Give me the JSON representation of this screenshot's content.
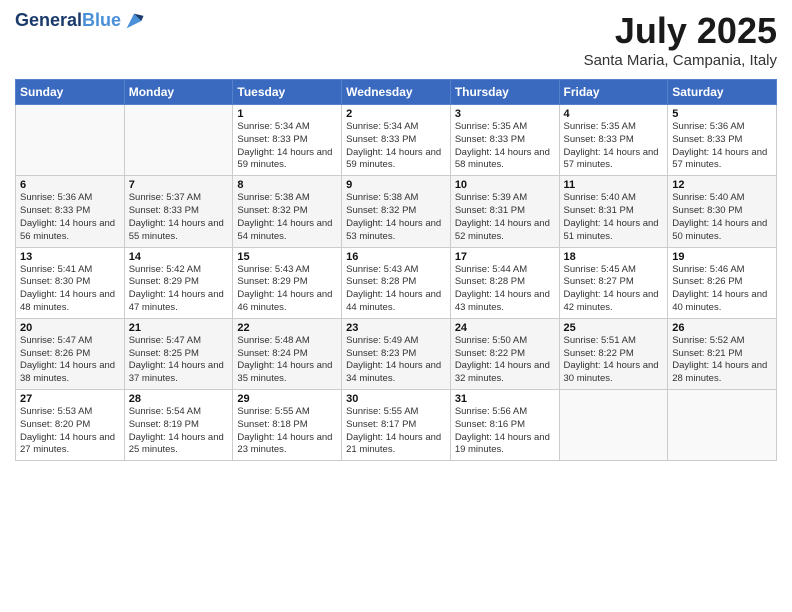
{
  "header": {
    "logo_line1": "General",
    "logo_line2": "Blue",
    "month": "July 2025",
    "location": "Santa Maria, Campania, Italy"
  },
  "weekdays": [
    "Sunday",
    "Monday",
    "Tuesday",
    "Wednesday",
    "Thursday",
    "Friday",
    "Saturday"
  ],
  "weeks": [
    [
      {
        "day": "",
        "sunrise": "",
        "sunset": "",
        "daylight": ""
      },
      {
        "day": "",
        "sunrise": "",
        "sunset": "",
        "daylight": ""
      },
      {
        "day": "1",
        "sunrise": "Sunrise: 5:34 AM",
        "sunset": "Sunset: 8:33 PM",
        "daylight": "Daylight: 14 hours and 59 minutes."
      },
      {
        "day": "2",
        "sunrise": "Sunrise: 5:34 AM",
        "sunset": "Sunset: 8:33 PM",
        "daylight": "Daylight: 14 hours and 59 minutes."
      },
      {
        "day": "3",
        "sunrise": "Sunrise: 5:35 AM",
        "sunset": "Sunset: 8:33 PM",
        "daylight": "Daylight: 14 hours and 58 minutes."
      },
      {
        "day": "4",
        "sunrise": "Sunrise: 5:35 AM",
        "sunset": "Sunset: 8:33 PM",
        "daylight": "Daylight: 14 hours and 57 minutes."
      },
      {
        "day": "5",
        "sunrise": "Sunrise: 5:36 AM",
        "sunset": "Sunset: 8:33 PM",
        "daylight": "Daylight: 14 hours and 57 minutes."
      }
    ],
    [
      {
        "day": "6",
        "sunrise": "Sunrise: 5:36 AM",
        "sunset": "Sunset: 8:33 PM",
        "daylight": "Daylight: 14 hours and 56 minutes."
      },
      {
        "day": "7",
        "sunrise": "Sunrise: 5:37 AM",
        "sunset": "Sunset: 8:33 PM",
        "daylight": "Daylight: 14 hours and 55 minutes."
      },
      {
        "day": "8",
        "sunrise": "Sunrise: 5:38 AM",
        "sunset": "Sunset: 8:32 PM",
        "daylight": "Daylight: 14 hours and 54 minutes."
      },
      {
        "day": "9",
        "sunrise": "Sunrise: 5:38 AM",
        "sunset": "Sunset: 8:32 PM",
        "daylight": "Daylight: 14 hours and 53 minutes."
      },
      {
        "day": "10",
        "sunrise": "Sunrise: 5:39 AM",
        "sunset": "Sunset: 8:31 PM",
        "daylight": "Daylight: 14 hours and 52 minutes."
      },
      {
        "day": "11",
        "sunrise": "Sunrise: 5:40 AM",
        "sunset": "Sunset: 8:31 PM",
        "daylight": "Daylight: 14 hours and 51 minutes."
      },
      {
        "day": "12",
        "sunrise": "Sunrise: 5:40 AM",
        "sunset": "Sunset: 8:30 PM",
        "daylight": "Daylight: 14 hours and 50 minutes."
      }
    ],
    [
      {
        "day": "13",
        "sunrise": "Sunrise: 5:41 AM",
        "sunset": "Sunset: 8:30 PM",
        "daylight": "Daylight: 14 hours and 48 minutes."
      },
      {
        "day": "14",
        "sunrise": "Sunrise: 5:42 AM",
        "sunset": "Sunset: 8:29 PM",
        "daylight": "Daylight: 14 hours and 47 minutes."
      },
      {
        "day": "15",
        "sunrise": "Sunrise: 5:43 AM",
        "sunset": "Sunset: 8:29 PM",
        "daylight": "Daylight: 14 hours and 46 minutes."
      },
      {
        "day": "16",
        "sunrise": "Sunrise: 5:43 AM",
        "sunset": "Sunset: 8:28 PM",
        "daylight": "Daylight: 14 hours and 44 minutes."
      },
      {
        "day": "17",
        "sunrise": "Sunrise: 5:44 AM",
        "sunset": "Sunset: 8:28 PM",
        "daylight": "Daylight: 14 hours and 43 minutes."
      },
      {
        "day": "18",
        "sunrise": "Sunrise: 5:45 AM",
        "sunset": "Sunset: 8:27 PM",
        "daylight": "Daylight: 14 hours and 42 minutes."
      },
      {
        "day": "19",
        "sunrise": "Sunrise: 5:46 AM",
        "sunset": "Sunset: 8:26 PM",
        "daylight": "Daylight: 14 hours and 40 minutes."
      }
    ],
    [
      {
        "day": "20",
        "sunrise": "Sunrise: 5:47 AM",
        "sunset": "Sunset: 8:26 PM",
        "daylight": "Daylight: 14 hours and 38 minutes."
      },
      {
        "day": "21",
        "sunrise": "Sunrise: 5:47 AM",
        "sunset": "Sunset: 8:25 PM",
        "daylight": "Daylight: 14 hours and 37 minutes."
      },
      {
        "day": "22",
        "sunrise": "Sunrise: 5:48 AM",
        "sunset": "Sunset: 8:24 PM",
        "daylight": "Daylight: 14 hours and 35 minutes."
      },
      {
        "day": "23",
        "sunrise": "Sunrise: 5:49 AM",
        "sunset": "Sunset: 8:23 PM",
        "daylight": "Daylight: 14 hours and 34 minutes."
      },
      {
        "day": "24",
        "sunrise": "Sunrise: 5:50 AM",
        "sunset": "Sunset: 8:22 PM",
        "daylight": "Daylight: 14 hours and 32 minutes."
      },
      {
        "day": "25",
        "sunrise": "Sunrise: 5:51 AM",
        "sunset": "Sunset: 8:22 PM",
        "daylight": "Daylight: 14 hours and 30 minutes."
      },
      {
        "day": "26",
        "sunrise": "Sunrise: 5:52 AM",
        "sunset": "Sunset: 8:21 PM",
        "daylight": "Daylight: 14 hours and 28 minutes."
      }
    ],
    [
      {
        "day": "27",
        "sunrise": "Sunrise: 5:53 AM",
        "sunset": "Sunset: 8:20 PM",
        "daylight": "Daylight: 14 hours and 27 minutes."
      },
      {
        "day": "28",
        "sunrise": "Sunrise: 5:54 AM",
        "sunset": "Sunset: 8:19 PM",
        "daylight": "Daylight: 14 hours and 25 minutes."
      },
      {
        "day": "29",
        "sunrise": "Sunrise: 5:55 AM",
        "sunset": "Sunset: 8:18 PM",
        "daylight": "Daylight: 14 hours and 23 minutes."
      },
      {
        "day": "30",
        "sunrise": "Sunrise: 5:55 AM",
        "sunset": "Sunset: 8:17 PM",
        "daylight": "Daylight: 14 hours and 21 minutes."
      },
      {
        "day": "31",
        "sunrise": "Sunrise: 5:56 AM",
        "sunset": "Sunset: 8:16 PM",
        "daylight": "Daylight: 14 hours and 19 minutes."
      },
      {
        "day": "",
        "sunrise": "",
        "sunset": "",
        "daylight": ""
      },
      {
        "day": "",
        "sunrise": "",
        "sunset": "",
        "daylight": ""
      }
    ]
  ]
}
